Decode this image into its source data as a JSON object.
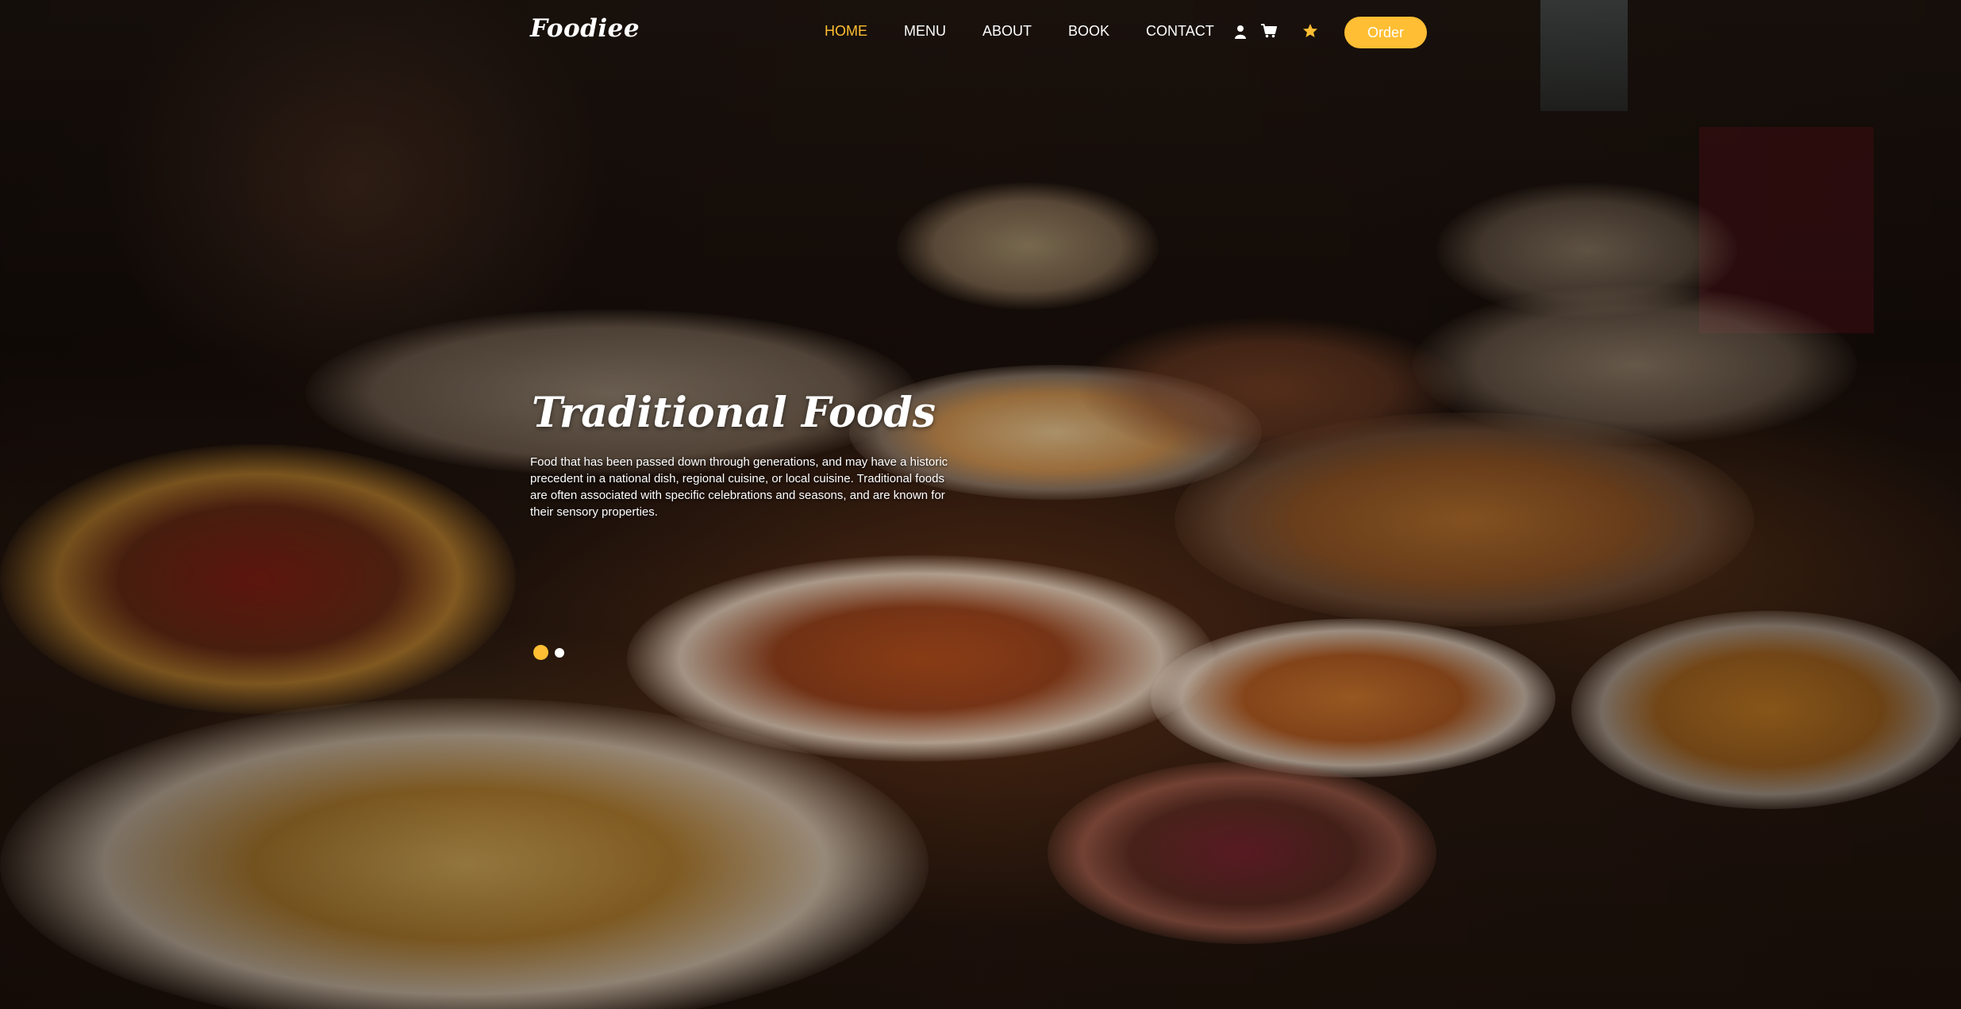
{
  "brand": {
    "logo_text": "Foodiee"
  },
  "nav": {
    "links": [
      {
        "label": "HOME",
        "active": true
      },
      {
        "label": "MENU",
        "active": false
      },
      {
        "label": "ABOUT",
        "active": false
      },
      {
        "label": "BOOK",
        "active": false
      },
      {
        "label": "CONTACT",
        "active": false
      }
    ],
    "icons": [
      "user-icon",
      "cart-icon",
      "star-icon"
    ],
    "order_label": "Order"
  },
  "hero": {
    "title": "Traditional Foods",
    "description": "Food that has been passed down through generations, and may have a historic precedent in a national dish, regional cuisine, or local cuisine. Traditional foods are often associated with specific celebrations and seasons, and are known for their sensory properties.",
    "slides_total": 2,
    "slide_active": 1
  },
  "colors": {
    "accent": "#ffbe33",
    "text": "#ffffff",
    "background": "#120b07"
  }
}
